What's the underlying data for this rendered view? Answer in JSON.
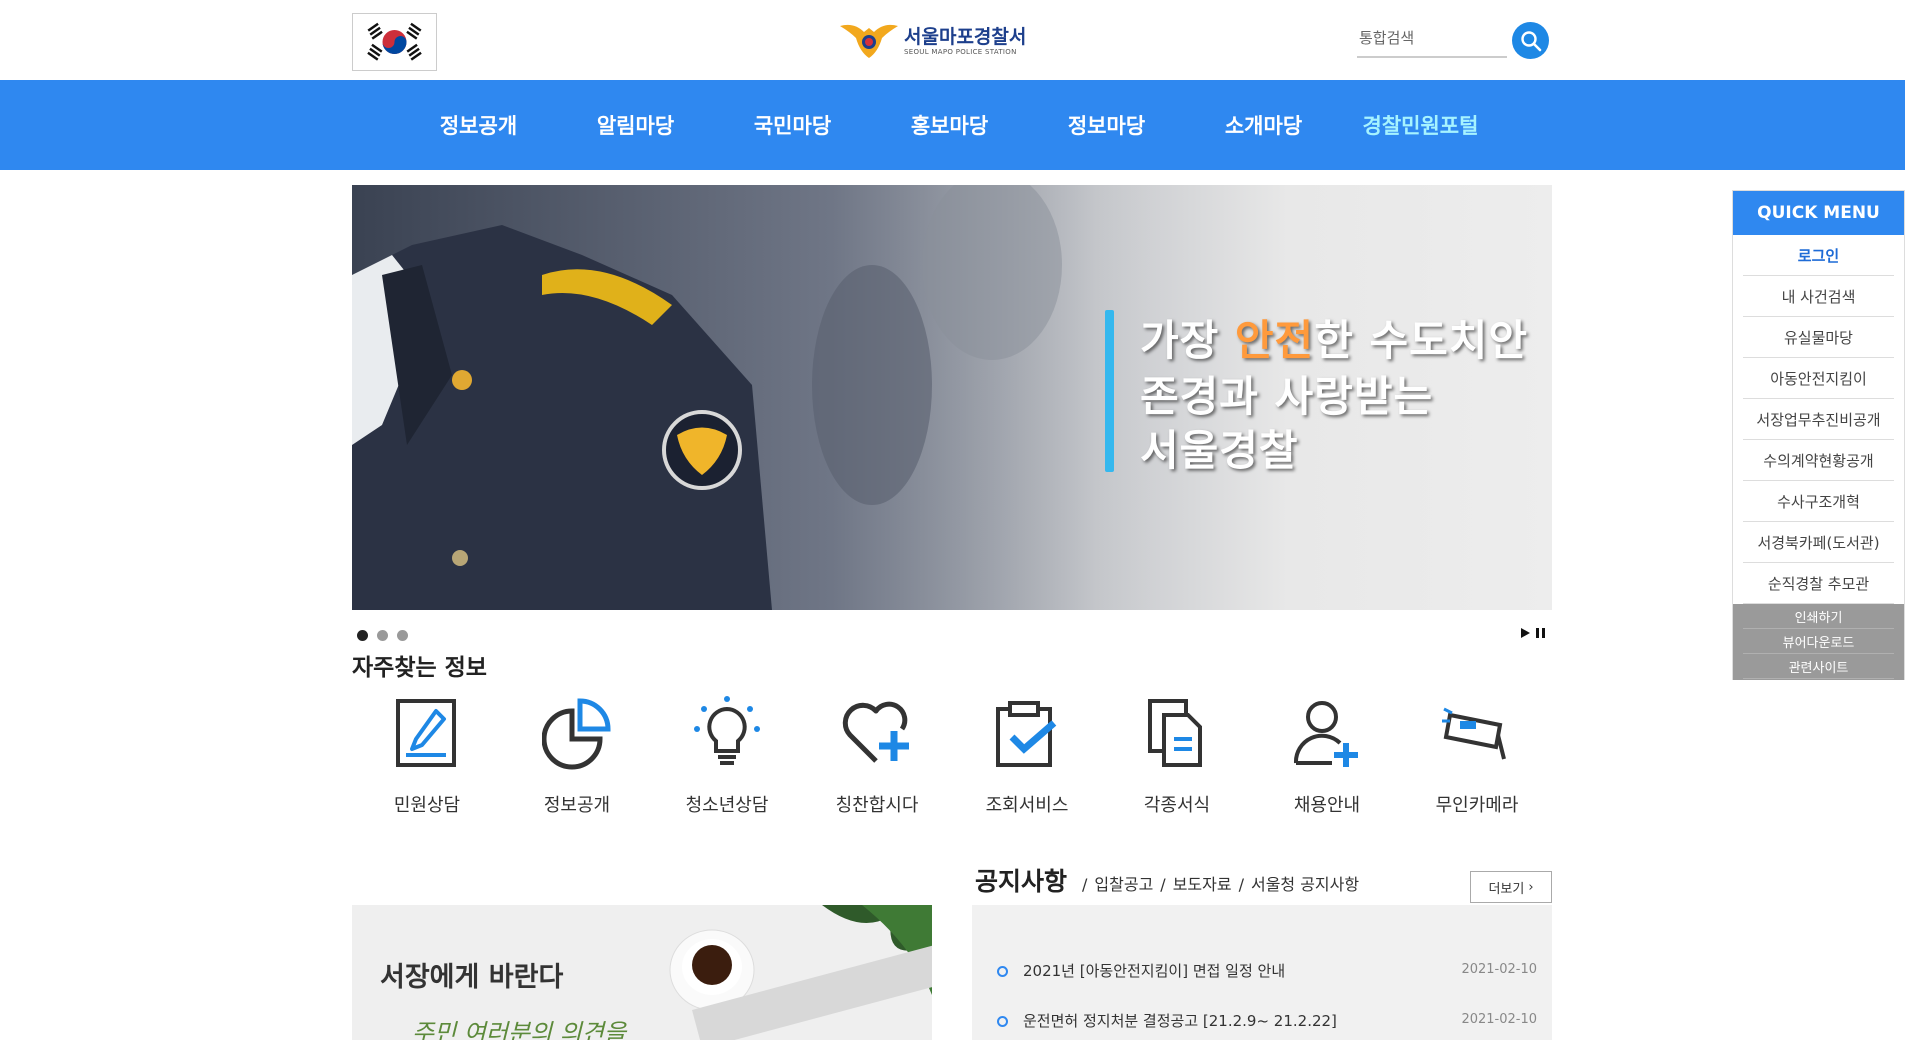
{
  "header": {
    "logo_title": "서울마포경찰서",
    "logo_subtitle": "SEOUL MAPO POLICE STATION",
    "search_placeholder": "통합검색"
  },
  "nav": {
    "items": [
      {
        "label": "정보공개"
      },
      {
        "label": "알림마당"
      },
      {
        "label": "국민마당"
      },
      {
        "label": "홍보마당"
      },
      {
        "label": "정보마당"
      },
      {
        "label": "소개마당"
      },
      {
        "label": "경찰민원포털"
      }
    ]
  },
  "banner": {
    "line1_a": "가장 ",
    "line1_hl": "안전",
    "line1_b": "한 수도치안",
    "line2": "존경과 사랑받는",
    "line3": "서울경찰"
  },
  "frequent": {
    "title": "자주찾는 정보",
    "items": [
      {
        "label": "민원상담",
        "icon": "pencil-document-icon"
      },
      {
        "label": "정보공개",
        "icon": "pie-chart-icon"
      },
      {
        "label": "청소년상담",
        "icon": "lightbulb-icon"
      },
      {
        "label": "칭찬합시다",
        "icon": "heart-plus-icon"
      },
      {
        "label": "조회서비스",
        "icon": "clipboard-check-icon"
      },
      {
        "label": "각종서식",
        "icon": "documents-icon"
      },
      {
        "label": "채용안내",
        "icon": "user-plus-icon"
      },
      {
        "label": "무인카메라",
        "icon": "camera-icon"
      }
    ]
  },
  "chief": {
    "title": "서장에게 바란다",
    "subtitle": "주민 여러분의 의견을"
  },
  "notice": {
    "title": "공지사항",
    "tabs": [
      "입찰공고",
      "보도자료",
      "서울청 공지사항"
    ],
    "more_label": "더보기",
    "rows": [
      {
        "title": "2021년 [아동안전지킴이] 면접 일정 안내",
        "date": "2021-02-10"
      },
      {
        "title": "운전면허 정지처분 결정공고 [21.2.9~ 21.2.22]",
        "date": "2021-02-10"
      }
    ]
  },
  "quick_menu": {
    "title": "QUICK MENU",
    "items": [
      "로그인",
      "내 사건검색",
      "유실물마당",
      "아동안전지킴이",
      "서장업무추진비공개",
      "수의계약현황공개",
      "수사구조개혁",
      "서경북카페(도서관)",
      "순직경찰 추모관"
    ],
    "footer": [
      "인쇄하기",
      "뷰어다운로드",
      "관련사이트"
    ]
  },
  "colors": {
    "primary": "#2f88f0",
    "accent_nav": "#a6f3ff",
    "banner_highlight": "#ff9a3c",
    "banner_bar": "#35b8ee"
  }
}
